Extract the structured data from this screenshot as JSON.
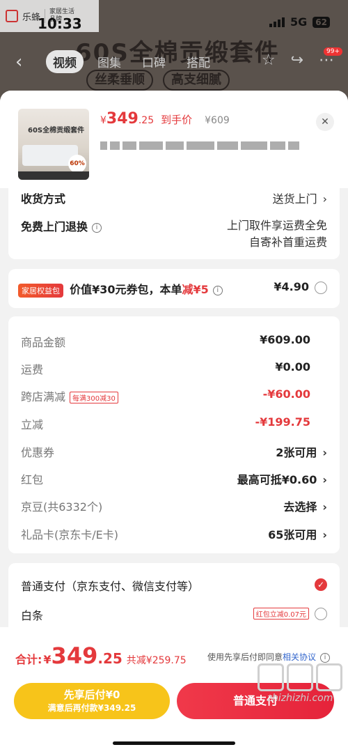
{
  "status_bar": {
    "time": "10:33",
    "network": "5G",
    "battery": "62"
  },
  "store": {
    "name": "乐蜂",
    "sub1": "家居生活",
    "sub2": "品牌"
  },
  "background": {
    "title": "60S全棉贡缎套件",
    "tabs": [
      "视频",
      "图集",
      "口碑",
      "搭配"
    ],
    "active_tab": "视频",
    "badge": "99+",
    "pills": [
      "丝柔垂顺",
      "高支细腻"
    ]
  },
  "product": {
    "thumb_title": "60S全棉贡缎套件",
    "thumb_discount": "60%",
    "price_symbol": "¥",
    "price_int": "349",
    "price_dec": ".25",
    "price_tag": "到手价",
    "orig_price": "¥609"
  },
  "delivery": {
    "label": "收货方式",
    "value": "送货上门"
  },
  "return_service": {
    "label": "免费上门退换",
    "line1": "上门取件享运费全免",
    "line2": "自寄补首重运费"
  },
  "perk": {
    "badge": "家居权益包",
    "text_prefix": "价值¥30元券包，本单",
    "text_red": "减¥5",
    "price": "¥4.90"
  },
  "summary": {
    "rows": [
      {
        "label": "商品金额",
        "value": "¥609.00"
      },
      {
        "label": "运费",
        "value": "¥0.00"
      },
      {
        "label": "跨店满减",
        "tag": "每满300减30",
        "value": "-¥60.00"
      },
      {
        "label": "立减",
        "value": "-¥199.75"
      },
      {
        "label": "优惠券",
        "value": "2张可用"
      },
      {
        "label": "红包",
        "value": "最高可抵¥0.60"
      },
      {
        "label": "京豆(共6332个)",
        "value": "去选择"
      },
      {
        "label": "礼品卡(京东卡/E卡)",
        "value": "65张可用"
      }
    ]
  },
  "payment": {
    "option1": "普通支付（京东支付、微信支付等）",
    "option2": "白条",
    "option2_tag": "红包立减0.07元"
  },
  "bottom": {
    "total_label": "合计:",
    "total_symbol": "¥",
    "total_int": "349",
    "total_dec": ".25",
    "total_save": "共减¥259.75",
    "agree_text": "使用先享后付即同意",
    "agree_link": "相关协议",
    "later_line1": "先享后付¥0",
    "later_line2": "满意后再付款¥349.25",
    "pay_label": "普通支付"
  },
  "watermark": {
    "text": "zhizhizhi.com"
  }
}
